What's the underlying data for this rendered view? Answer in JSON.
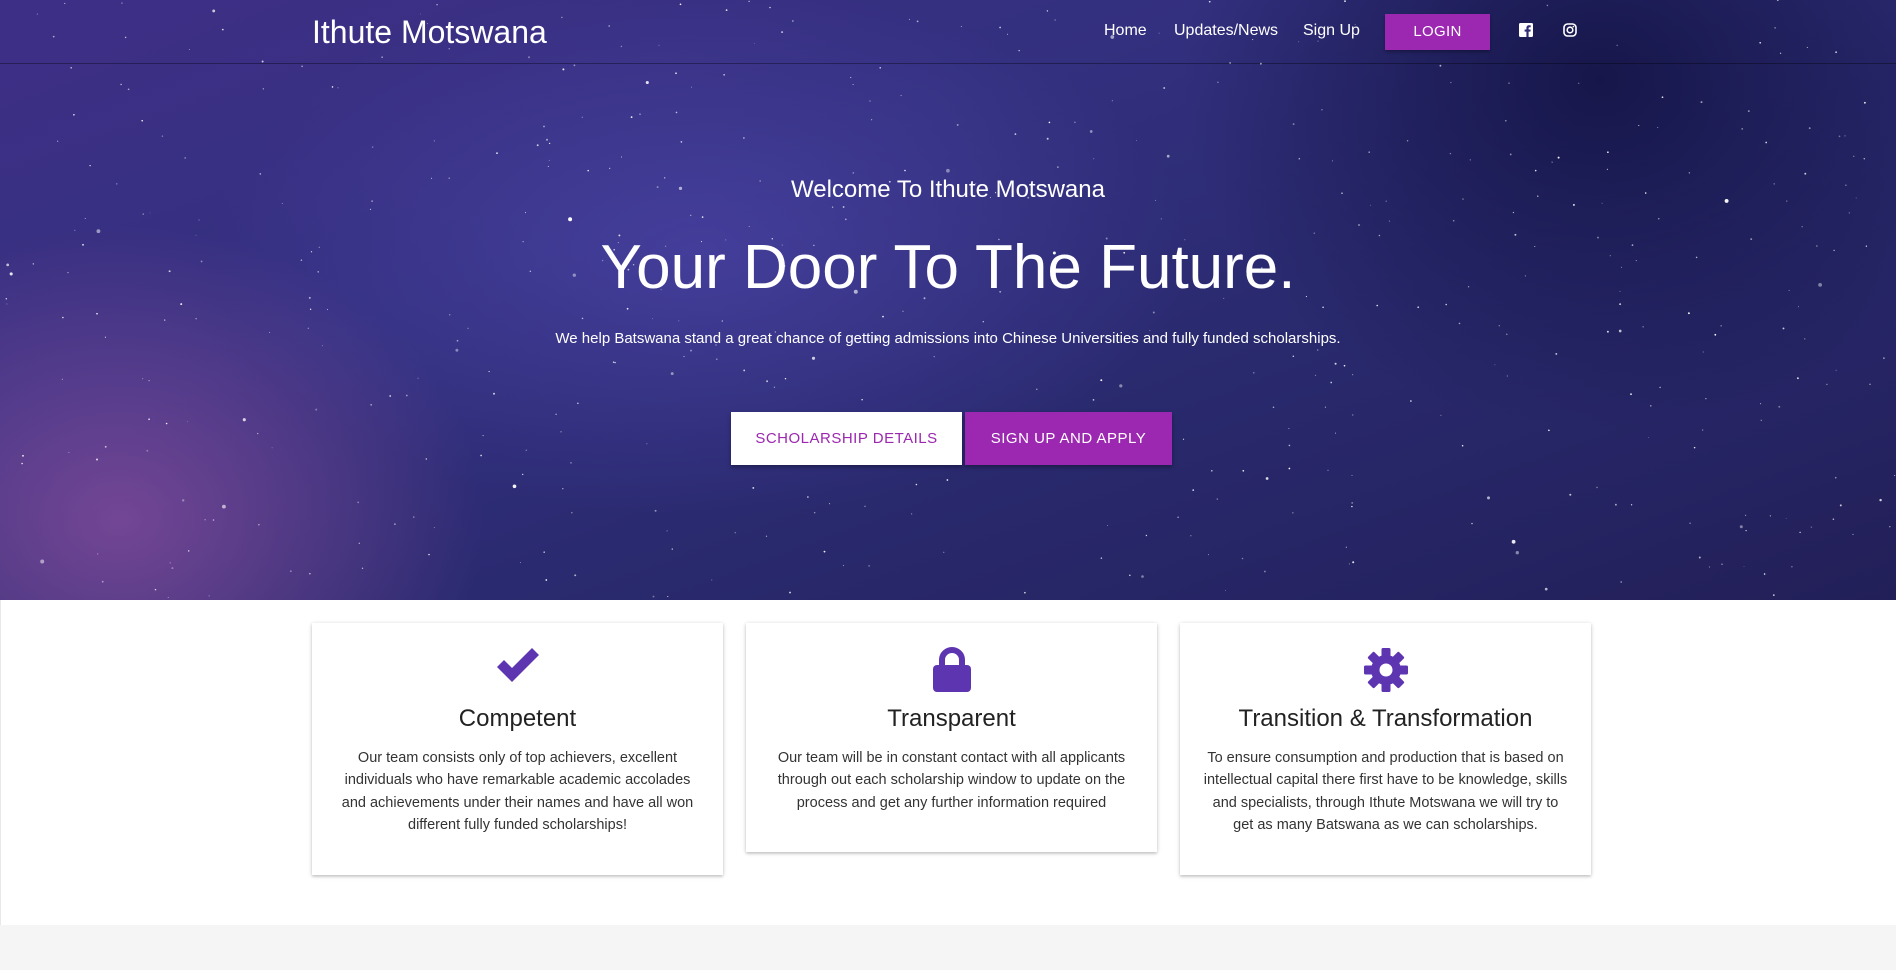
{
  "navbar": {
    "brand": "Ithute Motswana",
    "links": [
      {
        "label": "Home"
      },
      {
        "label": "Updates/News"
      },
      {
        "label": "Sign Up"
      }
    ],
    "login_label": "LOGIN",
    "social": [
      {
        "icon": "facebook-icon"
      },
      {
        "icon": "instagram-icon"
      }
    ]
  },
  "hero": {
    "welcome": "Welcome To Ithute Motswana",
    "headline": "Your Door To The Future.",
    "tagline": "We help Batswana stand a great chance of getting admissions into Chinese Universities and fully funded scholarships.",
    "buttons": {
      "scholarship_details": "SCHOLARSHIP DETAILS",
      "sign_up_apply": "SIGN UP AND APPLY"
    }
  },
  "features": [
    {
      "icon": "checkmark-icon",
      "title": "Competent",
      "text": "Our team consists only of top achievers, excellent individuals who have remarkable academic accolades and achievements under their names and have all won different fully funded scholarships!"
    },
    {
      "icon": "lock-icon",
      "title": "Transparent",
      "text": "Our team will be in constant contact with all applicants through out each scholarship window to update on the process and get any further information required"
    },
    {
      "icon": "gear-icon",
      "title": "Transition & Transformation",
      "text": "To ensure consumption and production that is based on intellectual capital there first have to be knowledge, skills and specialists, through Ithute Motswana we will try to get as many Batswana as we can scholarships."
    }
  ],
  "colors": {
    "accent": "#9c27b0",
    "icon": "#5e35b1"
  }
}
